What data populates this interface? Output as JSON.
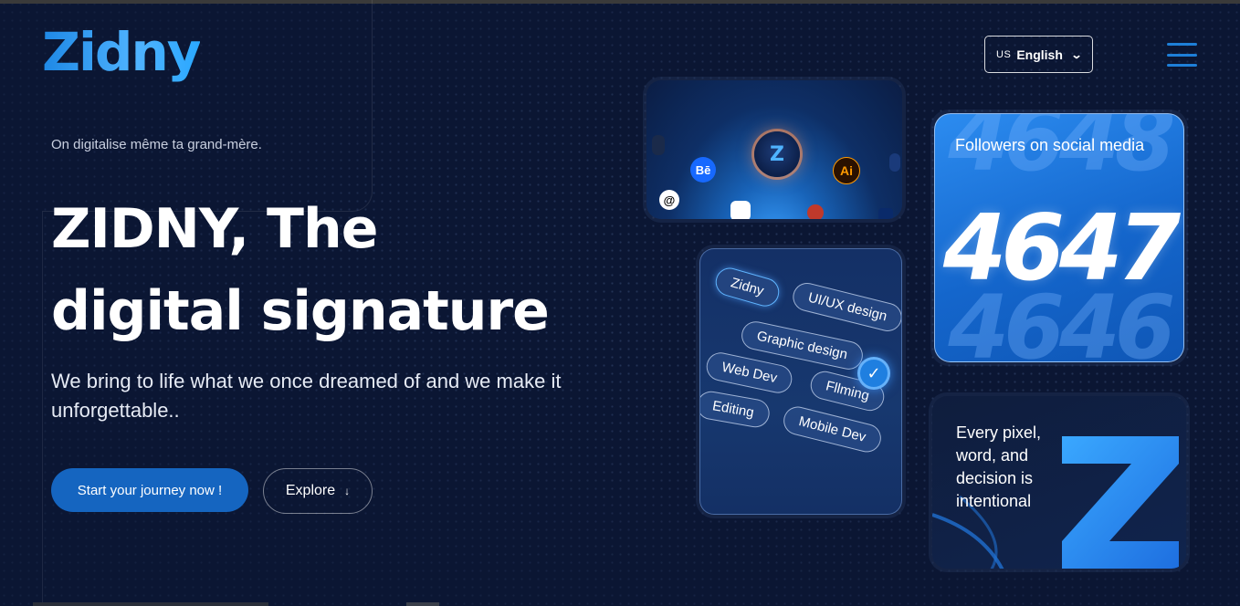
{
  "header": {
    "logo_text": "Zidny",
    "language": {
      "flag": "US",
      "label": "English"
    }
  },
  "hero": {
    "tagline": "On digitalise même ta grand-mère.",
    "headline_line1": "ZIDNY, The",
    "headline_line2": "digital signature",
    "subtitle": "We bring to life what we once dreamed of and we make it unforgettable..",
    "cta_primary": "Start your journey now !",
    "cta_secondary": "Explore",
    "cta_secondary_icon": "arrow-down-icon"
  },
  "tools_card": {
    "center_logo": "Z",
    "icons": [
      "Bē",
      "Ai"
    ]
  },
  "followers_card": {
    "label": "Followers on social media",
    "count": "4647",
    "ghost_above": "4648",
    "ghost_below": "4646"
  },
  "skills_card": {
    "pills": [
      "Zidny",
      "UI/UX design",
      "Graphic design",
      "Web Dev",
      "Fllming",
      "Editing",
      "Mobile Dev"
    ]
  },
  "pixel_card": {
    "text": "Every pixel, word, and decision is intentional",
    "logo_letter": "Z"
  },
  "colors": {
    "background": "#0b1633",
    "accent": "#1565c0",
    "brand_blue": "#2aa8ff"
  }
}
